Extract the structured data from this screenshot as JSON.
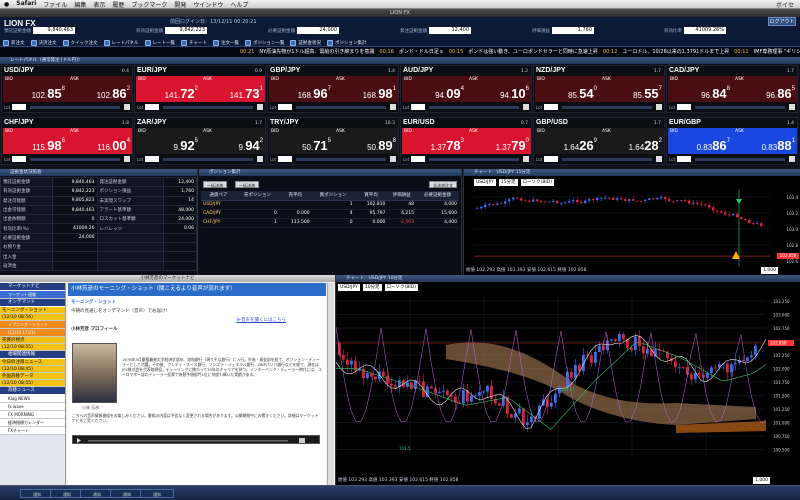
{
  "mac_menu": {
    "items": [
      "Safari",
      "ファイル",
      "編集",
      "表示",
      "履歴",
      "ブックマーク",
      "開発",
      "ウインドウ",
      "ヘルプ"
    ],
    "right": "ボイセ"
  },
  "window_title": "LION FX",
  "header": {
    "logo": "LION FX",
    "login": "前回ログイン日：13/12/11 00:20:21",
    "logout": "ログアウト",
    "accounts": [
      {
        "k": "預託証拠金額",
        "v": "9,840,463"
      },
      {
        "k": "有効証拠金額",
        "v": "9,842,223"
      },
      {
        "k": "必要証拠金額",
        "v": "24,000"
      },
      {
        "k": "発注証拠金額",
        "v": "12,400"
      },
      {
        "k": "評価損益",
        "v": "1,760"
      },
      {
        "k": "有効比率",
        "v": "41009.26%"
      }
    ]
  },
  "toolbar": [
    "新注文",
    "決済注文",
    "クイック注文",
    "レートパネル",
    "レート一覧",
    "チャート",
    "注文一覧",
    "ポジション一覧",
    "証拠金状況",
    "ポジション集計"
  ],
  "ticker": [
    {
      "time": "00:21",
      "text": "NY原油先物が1ドル超高、需給の引き締まりを意識"
    },
    {
      "time": "00:16",
      "text": "ポンド・ドル日足ｓ"
    },
    {
      "time": "00:15",
      "text": "ポンドは強い動き、ユーロポンドセラーと同時に急速上昇"
    },
    {
      "time": "00:12",
      "text": "ユーロドル、10/26以来の1.3791ドルまで上昇"
    },
    {
      "time": "00:11",
      "text": "IMF専務理事 \"ギリシャ救済のメ"
    }
  ],
  "rate_panel": {
    "title": "レートパネル（通常発注 [ドル円]）"
  },
  "tiles": [
    {
      "pair": "USD/JPY",
      "spread": "0.4",
      "bid_big": "102.85",
      "bid_sup": "8",
      "ask_big": "102.86",
      "ask_sup": "2",
      "style": "t-mix"
    },
    {
      "pair": "EUR/JPY",
      "spread": "0.9",
      "bid_big": "141.72",
      "bid_sup": "2",
      "ask_big": "141.73",
      "ask_sup": "1",
      "style": "t-red"
    },
    {
      "pair": "GBP/JPY",
      "spread": "1.4",
      "bid_big": "168.96",
      "bid_sup": "7",
      "ask_big": "168.98",
      "ask_sup": "1",
      "style": "t-mix"
    },
    {
      "pair": "AUD/JPY",
      "spread": "1.2",
      "bid_big": "94.09",
      "bid_sup": "4",
      "ask_big": "94.10",
      "ask_sup": "6",
      "style": "t-mix"
    },
    {
      "pair": "NZD/JPY",
      "spread": "1.7",
      "bid_big": "85.54",
      "bid_sup": "0",
      "ask_big": "85.55",
      "ask_sup": "7",
      "style": "t-mix"
    },
    {
      "pair": "CAD/JPY",
      "spread": "1.7",
      "bid_big": "96.84",
      "bid_sup": "8",
      "ask_big": "96.86",
      "ask_sup": "5",
      "style": "t-mix"
    },
    {
      "pair": "CHF/JPY",
      "spread": "1.8",
      "bid_big": "115.98",
      "bid_sup": "6",
      "ask_big": "116.00",
      "ask_sup": "4",
      "style": "t-red"
    },
    {
      "pair": "ZAR/JPY",
      "spread": "1.7",
      "bid_big": "9.92",
      "bid_sup": "5",
      "ask_big": "9.94",
      "ask_sup": "2",
      "style": "t-dark"
    },
    {
      "pair": "TRY/JPY",
      "spread": "18.3",
      "bid_big": "50.71",
      "bid_sup": "5",
      "ask_big": "50.89",
      "ask_sup": "8",
      "style": "t-dark"
    },
    {
      "pair": "EUR/USD",
      "spread": "0.7",
      "bid_big": "1.3778",
      "bid_sup": "3",
      "ask_big": "1.3779",
      "ask_sup": "0",
      "style": "t-red"
    },
    {
      "pair": "GBP/USD",
      "spread": "1.7",
      "bid_big": "1.6426",
      "bid_sup": "9",
      "ask_big": "1.6428",
      "ask_sup": "2",
      "style": "t-dark"
    },
    {
      "pair": "EUR/GBP",
      "spread": "1.4",
      "bid_big": "0.8386",
      "bid_sup": "7",
      "ask_big": "0.8388",
      "ask_sup": "1",
      "style": "t-blu"
    }
  ],
  "margin_panel": {
    "title": "証拠金状況照会",
    "rows": [
      [
        "預託証拠金額",
        "9,840,463",
        "発注証拠金額",
        "12,400"
      ],
      [
        "有効証拠金額",
        "9,842,223",
        "ポジション損益",
        "1,760"
      ],
      [
        "発注可能額",
        "9,805,823",
        "未実現スワップ",
        "14"
      ],
      [
        "出金可能額",
        "9,840,463",
        "アラート基準額",
        "48,000"
      ],
      [
        "出金依頼額",
        "0",
        "ロスカット基準額",
        "24,000"
      ],
      [
        "有効比率(%)",
        "41009.26",
        "レバレッジ",
        "0.06"
      ],
      [
        "必要証拠金額",
        "24,000",
        "",
        ""
      ],
      [
        "お預り金",
        "",
        "",
        ""
      ],
      [
        "出入金",
        "",
        "",
        ""
      ],
      [
        "返済金",
        "",
        "",
        ""
      ]
    ]
  },
  "position_panel": {
    "title": "ポジション集計",
    "buttons": [
      "一括決済",
      "一括決済",
      "全決済注文"
    ],
    "headers": [
      "通貨ペア",
      "売ポジション",
      "売平均",
      "買ポジション",
      "買平均",
      "評価損益",
      "必要証拠金額"
    ],
    "rows": [
      [
        "USD/JPY",
        "",
        "",
        "1",
        "102.810",
        "48",
        "4,000"
      ],
      [
        "CAD/JPY",
        "0",
        "0.000",
        "4",
        "95.797",
        "4,215",
        "15,600"
      ],
      [
        "CHF/JPY",
        "1",
        "113.500",
        "0",
        "0.000",
        "-2,503",
        "4,400"
      ]
    ]
  },
  "mini_chart": {
    "title": "チャート：USD/JPY 15分足",
    "pair": "USD/JPY",
    "tf": "15分足",
    "type": "ローソク(BID)",
    "amount": "1,000",
    "footer": "始値 102.293 高値 103.393 安値 102.615 終値 102.858",
    "y_ticks": [
      "103.4",
      "103.2",
      "103.0",
      "102.8",
      "102.6"
    ],
    "current": "102.858"
  },
  "news": {
    "window_title": "小林芳彦のマーケットナビ",
    "nav": [
      {
        "label": "マーケットナビ",
        "kind": "h"
      },
      {
        "label": "マーケット速報",
        "kind": "blue"
      },
      {
        "label": "オンデマンド",
        "kind": "h"
      },
      {
        "label": "モーニング・ショット",
        "kind": "sel"
      },
      {
        "label": "(12/10 08:56)",
        "kind": "sel"
      },
      {
        "label": "イブニング・ショット",
        "kind": "sel2"
      },
      {
        "label": "(12/10 17:21)",
        "kind": "sel2"
      },
      {
        "label": "売買の視点",
        "kind": "sel"
      },
      {
        "label": "(12/10 08:55)",
        "kind": "sel"
      },
      {
        "label": "相場関連情報",
        "kind": "h"
      },
      {
        "label": "今日の注目ニュース",
        "kind": "sel"
      },
      {
        "label": "(12/10 08:45)",
        "kind": "sel"
      },
      {
        "label": "外国為替データ",
        "kind": "sel"
      },
      {
        "label": "(12/10 08:55)",
        "kind": "sel"
      },
      {
        "label": "為替ニュース",
        "kind": "h"
      },
      {
        "label": "Klug NEWS",
        "kind": "i"
      },
      {
        "label": "fx wave",
        "kind": "i"
      },
      {
        "label": "FX MORNING",
        "kind": "i"
      },
      {
        "label": "経済指標カレンダー",
        "kind": "i"
      },
      {
        "label": "FXチャート",
        "kind": "i"
      }
    ],
    "headline": "小林芳彦のモーニング・ショット（聞こえるより音声が流れます）",
    "section": "モーニング・ショット",
    "sub1": "今朝の見通しをオンデマンド（音声）でお届け！",
    "sub2": "≫音声を聞くにはこちら",
    "profile": "小林芳彦 プロフィール",
    "caption": "小林 芳彦",
    "body": "1976年3月慶應義塾大学経済学部卒、協和銀行（現りそな銀行）に入行。外為・資金部を経て、オプション・ディーラーとして活躍。その後、クレディ・スイス銀行、ソシエテ・ジェネラル銀行、BNPパリバ銀行などを経て、現在はJFX株式会社代表取締役。ディーリングに携わって35年のキャリアを持つ。インターバンク・ディーラー時代には、ユーロマネー誌のディーラー投票で為替予想部門1位に何度も輝いた実績がある。",
    "body2": "こちらの音声情報番組をお楽しみください。番組の内容は予告なく変更される場合があります。公開期間中にお聞きください。詳細はマーケットナビをご覧ください。"
  },
  "main_chart": {
    "title": "チャート：USD/JPY 10分足",
    "pair": "USD/JPY",
    "tf": "10分足",
    "type": "ローソク(BID)",
    "amount": "1,000",
    "footer": "始値 103.293 高値 103.393 安値 102.615 終値 102.858",
    "x_ticks": [
      "2013/12/04",
      "12/05",
      "12/06",
      "12/09",
      "12/10",
      "12/11"
    ],
    "y_ticks": [
      "103.250",
      "103.000",
      "102.750",
      "102.500",
      "102.250",
      "102.000",
      "101.750",
      "101.500",
      "101.250",
      "101.000",
      "100.750",
      "100.500"
    ],
    "current": "102.858",
    "labels": [
      "103.11",
      "101.5"
    ]
  },
  "status_tabs": [
    "通知",
    "通知",
    "通知",
    "通知",
    "通知"
  ],
  "colors": {
    "bull": "#3a6cf5",
    "bear": "#e0203a",
    "cloud": "#b88a5c"
  }
}
